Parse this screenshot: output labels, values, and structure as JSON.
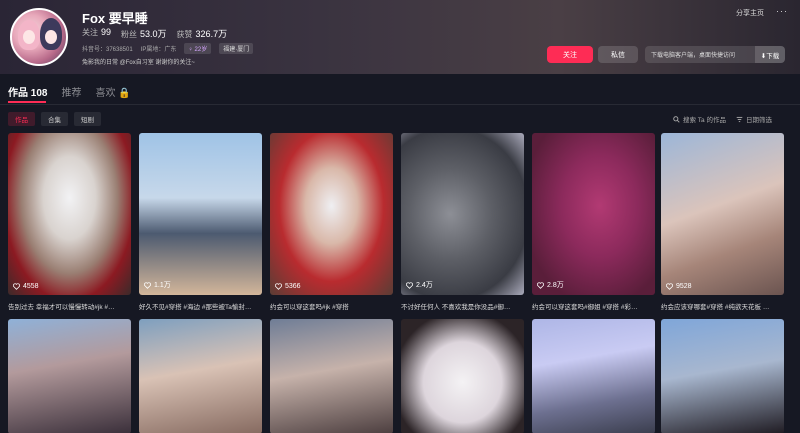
{
  "profile": {
    "name": "Fox 要早睡",
    "following_label": "关注",
    "following": "99",
    "fans_label": "粉丝",
    "fans": "53.0万",
    "likes_label": "获赞",
    "likes": "326.7万",
    "douyin_id": "抖音号：37638501",
    "ip": "IP属地：广东",
    "age_tag": "♀ 22岁",
    "location_tag": "福建·厦门",
    "bio": "兔影我的日常 @Fox自习室 谢谢你的关注~"
  },
  "actions": {
    "share": "分享主页",
    "more": "···",
    "follow": "关注",
    "message": "私信",
    "download_text": "下载电脑客户端，桌面快捷访问",
    "download_btn": "⬇下载"
  },
  "tabs": [
    {
      "label": "作品 108"
    },
    {
      "label": "推荐"
    },
    {
      "label": "喜欢 🔒"
    }
  ],
  "subtabs": [
    {
      "label": "作品"
    },
    {
      "label": "合集"
    },
    {
      "label": "短剧"
    }
  ],
  "search_ta": "搜索 Ta 的作品",
  "date_filter": "日期筛选",
  "videos": [
    {
      "likes": "4558",
      "caption": "告别过去 幸福才可以慢慢转动#jk #…"
    },
    {
      "likes": "1.1万",
      "caption": "好久不见#穿搭 #海边 #那些被Ta愉封…"
    },
    {
      "likes": "5366",
      "caption": "约会可以穿这套吗#jk #穿搭"
    },
    {
      "likes": "2.4万",
      "caption": "不讨好任何人 不喜欢我是你没品#御…"
    },
    {
      "likes": "2.8万",
      "caption": "约会可以穿这套吗#御姐 #穿搭 #彩…"
    },
    {
      "likes": "9528",
      "caption": "约会应该穿哪套#穿搭 #纯欲天花板 …"
    }
  ],
  "icons": {
    "heart": "heart-icon",
    "search": "search-icon",
    "filter": "filter-icon",
    "lock": "lock-icon"
  },
  "colors": {
    "accent": "#fe2c55",
    "background": "#161823"
  }
}
